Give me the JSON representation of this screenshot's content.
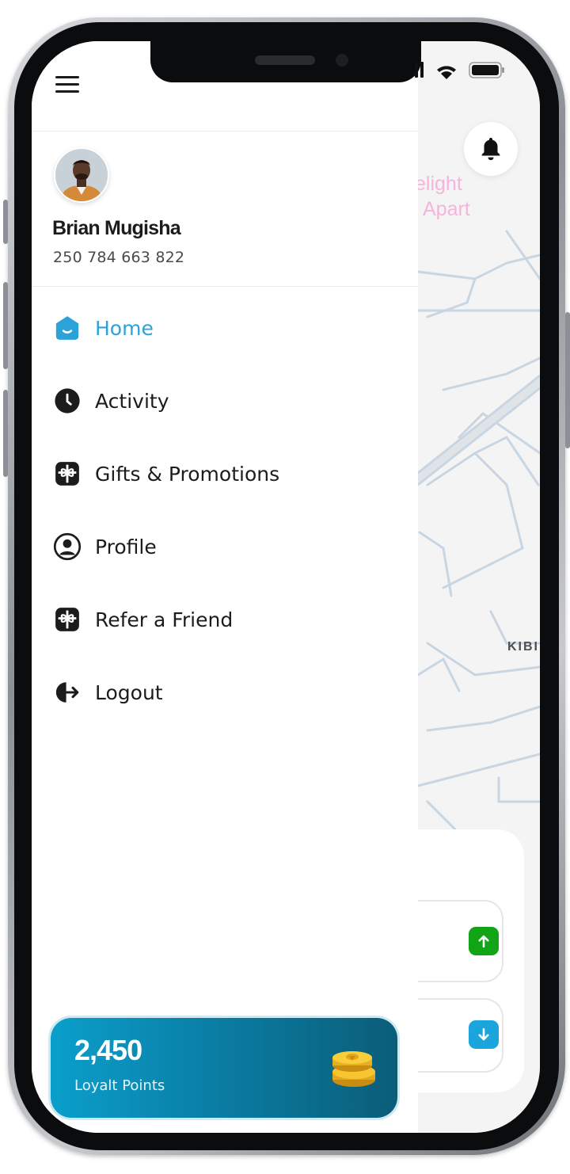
{
  "user": {
    "name": "Brian Mugisha",
    "phone": "250 784 663 822"
  },
  "menu": {
    "items": [
      {
        "label": "Home",
        "icon": "home-icon",
        "active": true
      },
      {
        "label": "Activity",
        "icon": "clock-icon",
        "active": false
      },
      {
        "label": "Gifts & Promotions",
        "icon": "gift-icon",
        "active": false
      },
      {
        "label": "Profile",
        "icon": "user-circle-icon",
        "active": false
      },
      {
        "label": "Refer a Friend",
        "icon": "gift-icon",
        "active": false
      },
      {
        "label": "Logout",
        "icon": "logout-icon",
        "active": false
      }
    ]
  },
  "loyalty": {
    "points": "2,450",
    "label": "Loyalt Points",
    "icon": "coins-icon"
  },
  "map": {
    "place_line1": "elight",
    "place_line2": "Apart",
    "district": "KIBI"
  },
  "colors": {
    "accent": "#2ba3d9",
    "up_green": "#12a417",
    "down_blue": "#1aa6dc",
    "place_pink": "#f5a8d8"
  }
}
